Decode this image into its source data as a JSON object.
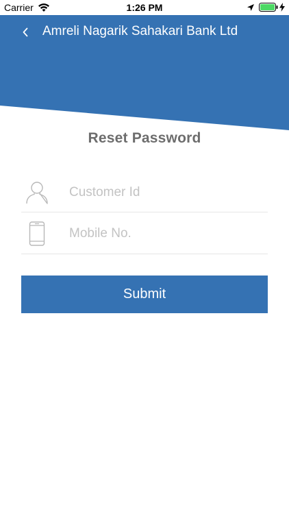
{
  "status_bar": {
    "carrier": "Carrier",
    "time": "1:26 PM",
    "icons": [
      "wifi-icon",
      "location-icon",
      "battery-icon",
      "charging-icon"
    ]
  },
  "header": {
    "title": "Amreli Nagarik Sahakari Bank Ltd",
    "back_icon": "chevron-left-icon",
    "background_color": "#3572b3"
  },
  "page": {
    "title": "Reset Password"
  },
  "form": {
    "customer_id": {
      "placeholder": "Customer Id",
      "value": "",
      "icon": "user-icon"
    },
    "mobile_no": {
      "placeholder": "Mobile No.",
      "value": "",
      "icon": "mobile-phone-icon"
    },
    "submit_label": "Submit"
  },
  "colors": {
    "primary": "#3572b3",
    "title_text": "#6d6d6d",
    "placeholder": "#c3c3c3",
    "divider": "#e6e6e6"
  }
}
